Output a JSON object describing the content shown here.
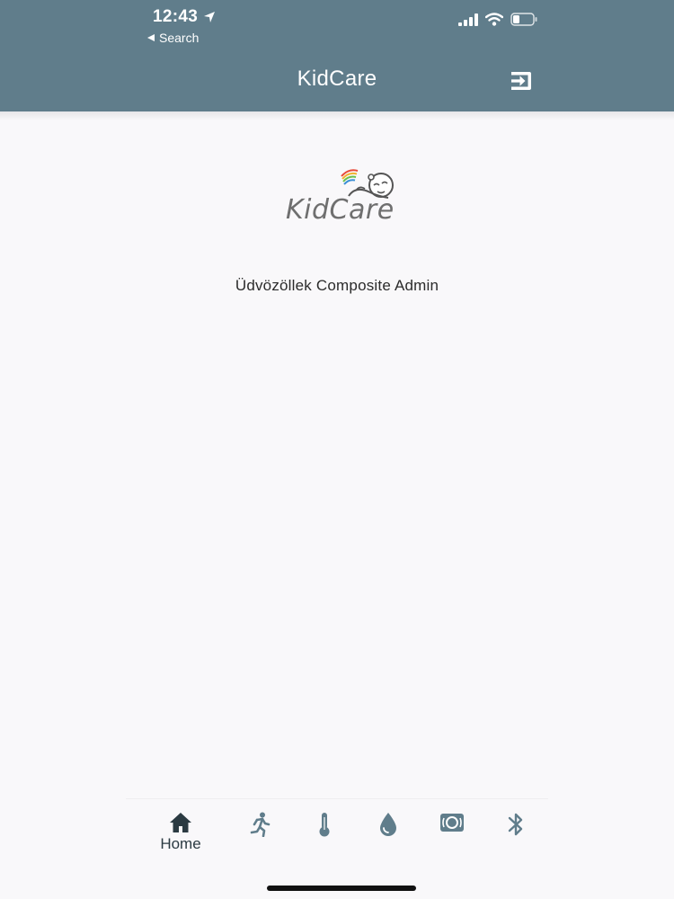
{
  "status_bar": {
    "time": "12:43",
    "back_label": "Search"
  },
  "app_bar": {
    "title": "KidCare",
    "logout_icon": "logout-icon"
  },
  "content": {
    "logo_text": "KidCare",
    "welcome_text": "Üdvözöllek Composite Admin"
  },
  "bottom_nav": {
    "items": [
      {
        "icon": "home-icon",
        "label": "Home",
        "selected": true
      },
      {
        "icon": "running-icon",
        "label": ""
      },
      {
        "icon": "thermometer-icon",
        "label": ""
      },
      {
        "icon": "water-drop-icon",
        "label": ""
      },
      {
        "icon": "sensor-icon",
        "label": ""
      },
      {
        "icon": "bluetooth-icon",
        "label": ""
      }
    ]
  },
  "colors": {
    "app_bar": "#607d8b",
    "background": "#f9f8fa",
    "nav_selected": "#2b3a42",
    "nav_icon": "#607d8b"
  }
}
